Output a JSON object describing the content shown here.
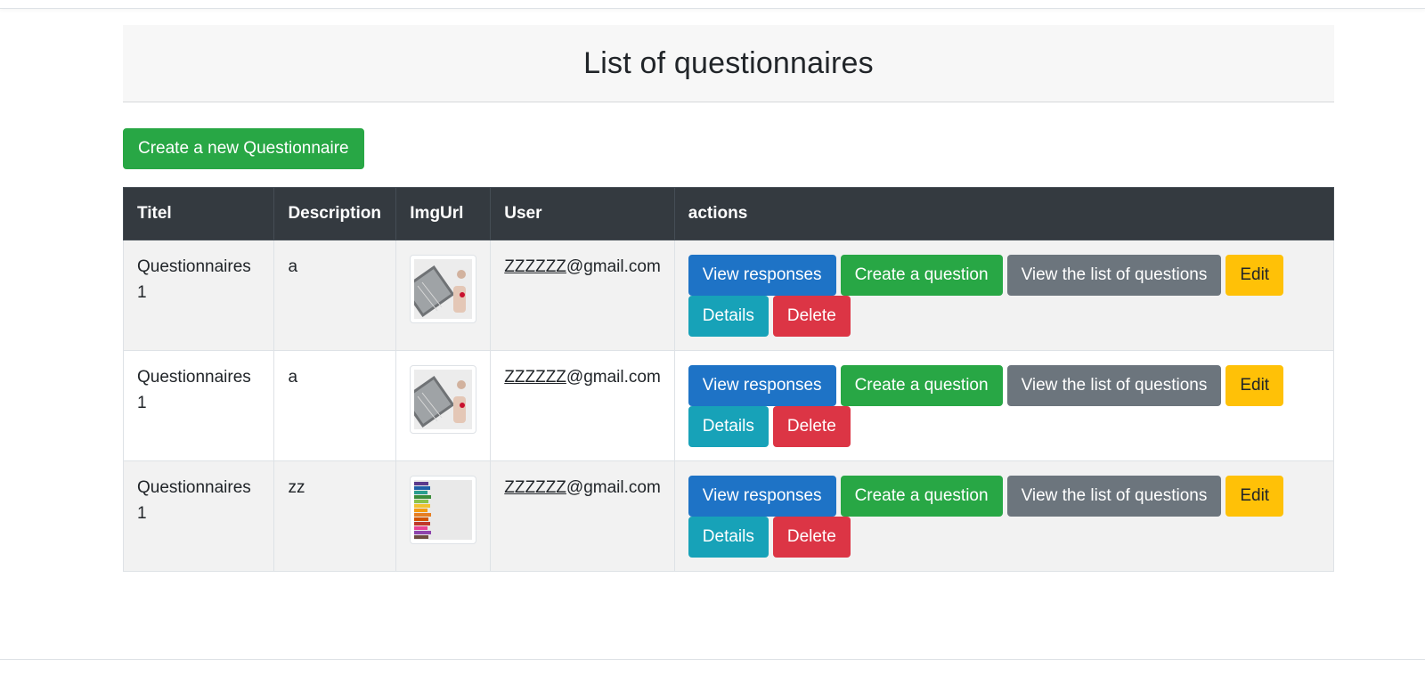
{
  "page": {
    "title": "List of questionnaires",
    "create_button": "Create a new Questionnaire"
  },
  "table": {
    "headers": [
      "Titel",
      "Description",
      "ImgUrl",
      "User",
      "actions"
    ],
    "rows": [
      {
        "title": "Questionnaires 1",
        "description": "a",
        "image": "laptop-desk-photo",
        "user_name": "ZZZZZZ",
        "user_domain": "@gmail.com"
      },
      {
        "title": "Questionnaires 1",
        "description": "a",
        "image": "laptop-desk-photo",
        "user_name": "ZZZZZZ",
        "user_domain": "@gmail.com"
      },
      {
        "title": "Questionnaires 1",
        "description": "zz",
        "image": "colored-pencils-photo",
        "user_name": "ZZZZZZ",
        "user_domain": "@gmail.com"
      }
    ],
    "actions": {
      "view_responses": "View responses",
      "create_question": "Create a question",
      "view_questions": "View the list of questions",
      "edit": "Edit",
      "details": "Details",
      "delete": "Delete"
    }
  },
  "colors": {
    "header_bg": "#343a40",
    "primary": "#1e73c6",
    "success": "#28a745",
    "secondary": "#6c757d",
    "warning": "#ffc107",
    "info": "#17a2b8",
    "danger": "#dc3545",
    "stripe": "#f2f2f2"
  }
}
